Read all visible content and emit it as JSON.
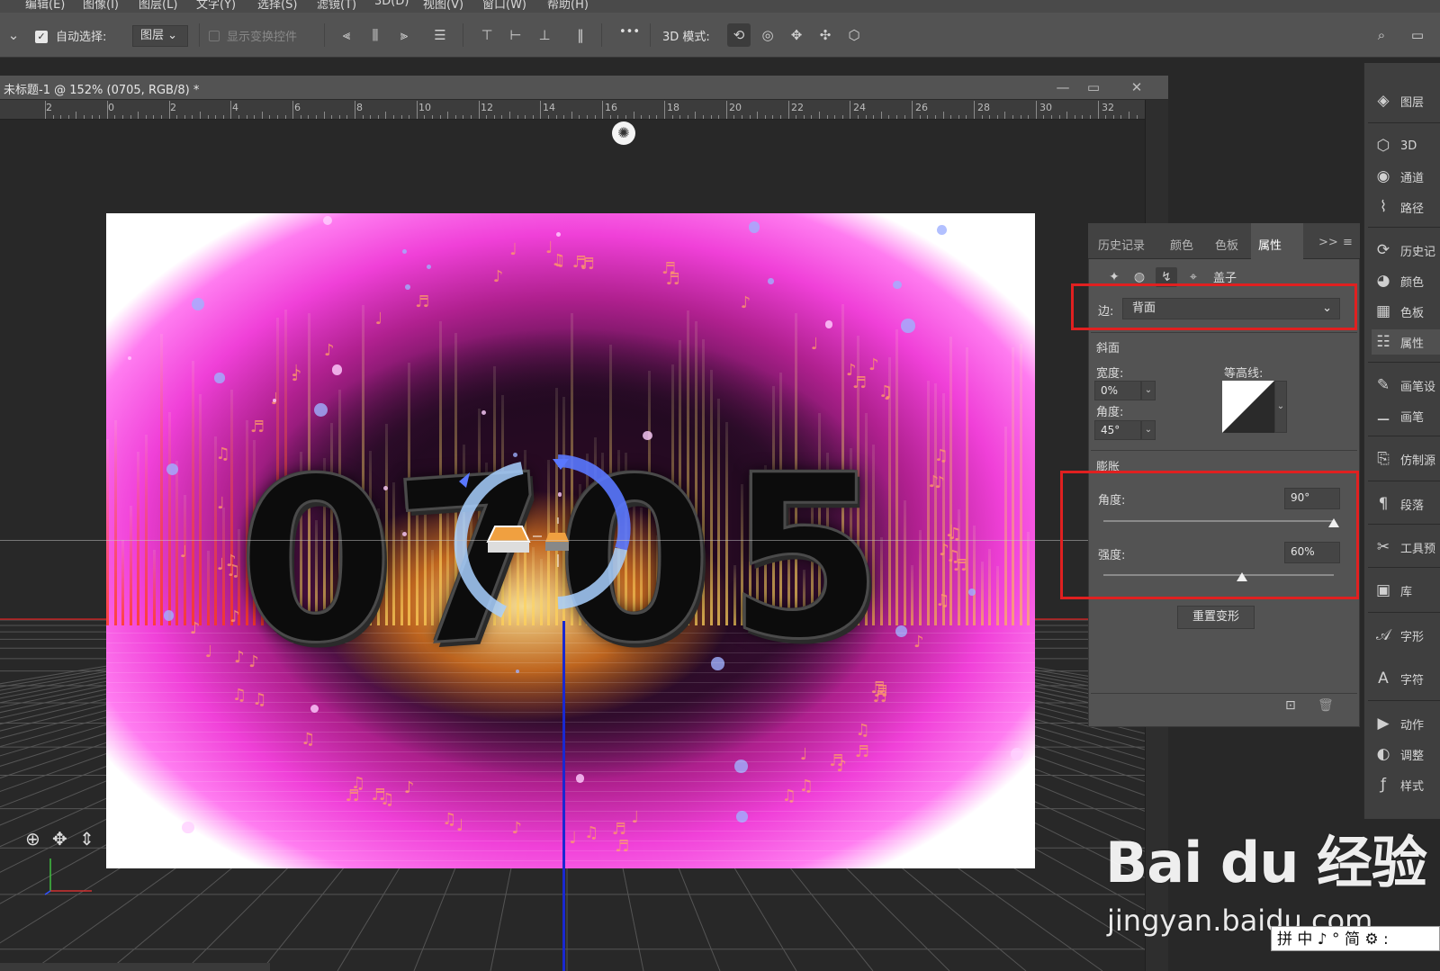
{
  "menubar": {
    "items": [
      "编辑(E)",
      "图像(I)",
      "图层(L)",
      "文字(Y)",
      "选择(S)",
      "滤镜(T)",
      "3D(D)",
      "视图(V)",
      "窗口(W)",
      "帮助(H)"
    ]
  },
  "options": {
    "auto_select_label": "自动选择:",
    "auto_select_checked": true,
    "target_value": "图层",
    "show_transform_label": "显示变换控件",
    "more_label": "•••",
    "mode_3d_label": "3D 模式:"
  },
  "document": {
    "title": "未标题-1 @ 152% (0705, RGB/8) *",
    "ruler_numbers": [
      "2",
      "0",
      "2",
      "4",
      "6",
      "8",
      "10",
      "12",
      "14",
      "16",
      "18",
      "20",
      "22",
      "24",
      "26",
      "28",
      "30",
      "32"
    ],
    "image_digits": [
      "0",
      "7",
      "0",
      "5"
    ]
  },
  "properties_panel": {
    "tabs": [
      "历史记录",
      "颜色",
      "色板",
      "属性"
    ],
    "active_tab": "属性",
    "collapse_label": ">>",
    "mode_label": "盖子",
    "side_label": "边:",
    "side_value": "背面",
    "bevel_section": "斜面",
    "width_label": "宽度:",
    "width_value": "0%",
    "contour_label": "等高线:",
    "angle_label": "角度:",
    "angle_value": "45°",
    "inflate_section": "膨胀",
    "inflate_angle_label": "角度:",
    "inflate_angle_value": "90°",
    "inflate_angle_fraction": 1.0,
    "strength_label": "强度:",
    "strength_value": "60%",
    "strength_fraction": 0.6,
    "reset_label": "重置变形"
  },
  "right_dock": {
    "items": [
      {
        "label": "图层",
        "icon": "layers-icon"
      },
      {
        "label": "3D",
        "icon": "cube-icon"
      },
      {
        "label": "通道",
        "icon": "channels-icon"
      },
      {
        "label": "路径",
        "icon": "paths-icon"
      },
      {
        "label": "历史记",
        "icon": "history-icon"
      },
      {
        "label": "颜色",
        "icon": "palette-icon"
      },
      {
        "label": "色板",
        "icon": "swatches-icon"
      },
      {
        "label": "属性",
        "icon": "properties-icon"
      },
      {
        "label": "画笔设",
        "icon": "brush-settings-icon"
      },
      {
        "label": "画笔",
        "icon": "brush-icon"
      },
      {
        "label": "仿制源",
        "icon": "clone-source-icon"
      },
      {
        "label": "段落",
        "icon": "paragraph-icon"
      },
      {
        "label": "工具预",
        "icon": "tool-presets-icon"
      },
      {
        "label": "库",
        "icon": "library-icon"
      },
      {
        "label": "字形",
        "icon": "glyphs-icon"
      },
      {
        "label": "字符",
        "icon": "character-icon"
      },
      {
        "label": "动作",
        "icon": "actions-icon"
      },
      {
        "label": "调整",
        "icon": "adjustments-icon"
      },
      {
        "label": "样式",
        "icon": "styles-icon"
      }
    ]
  },
  "watermark": {
    "logo": "Bai du 经验",
    "url": "jingyan.baidu.com"
  },
  "ime_bar": "拼 中 ♪ ° 简 ⚙ :",
  "colors": {
    "highlight_red": "#e02020",
    "panel_bg": "#535353",
    "dock_bg": "#3f3f3f"
  }
}
